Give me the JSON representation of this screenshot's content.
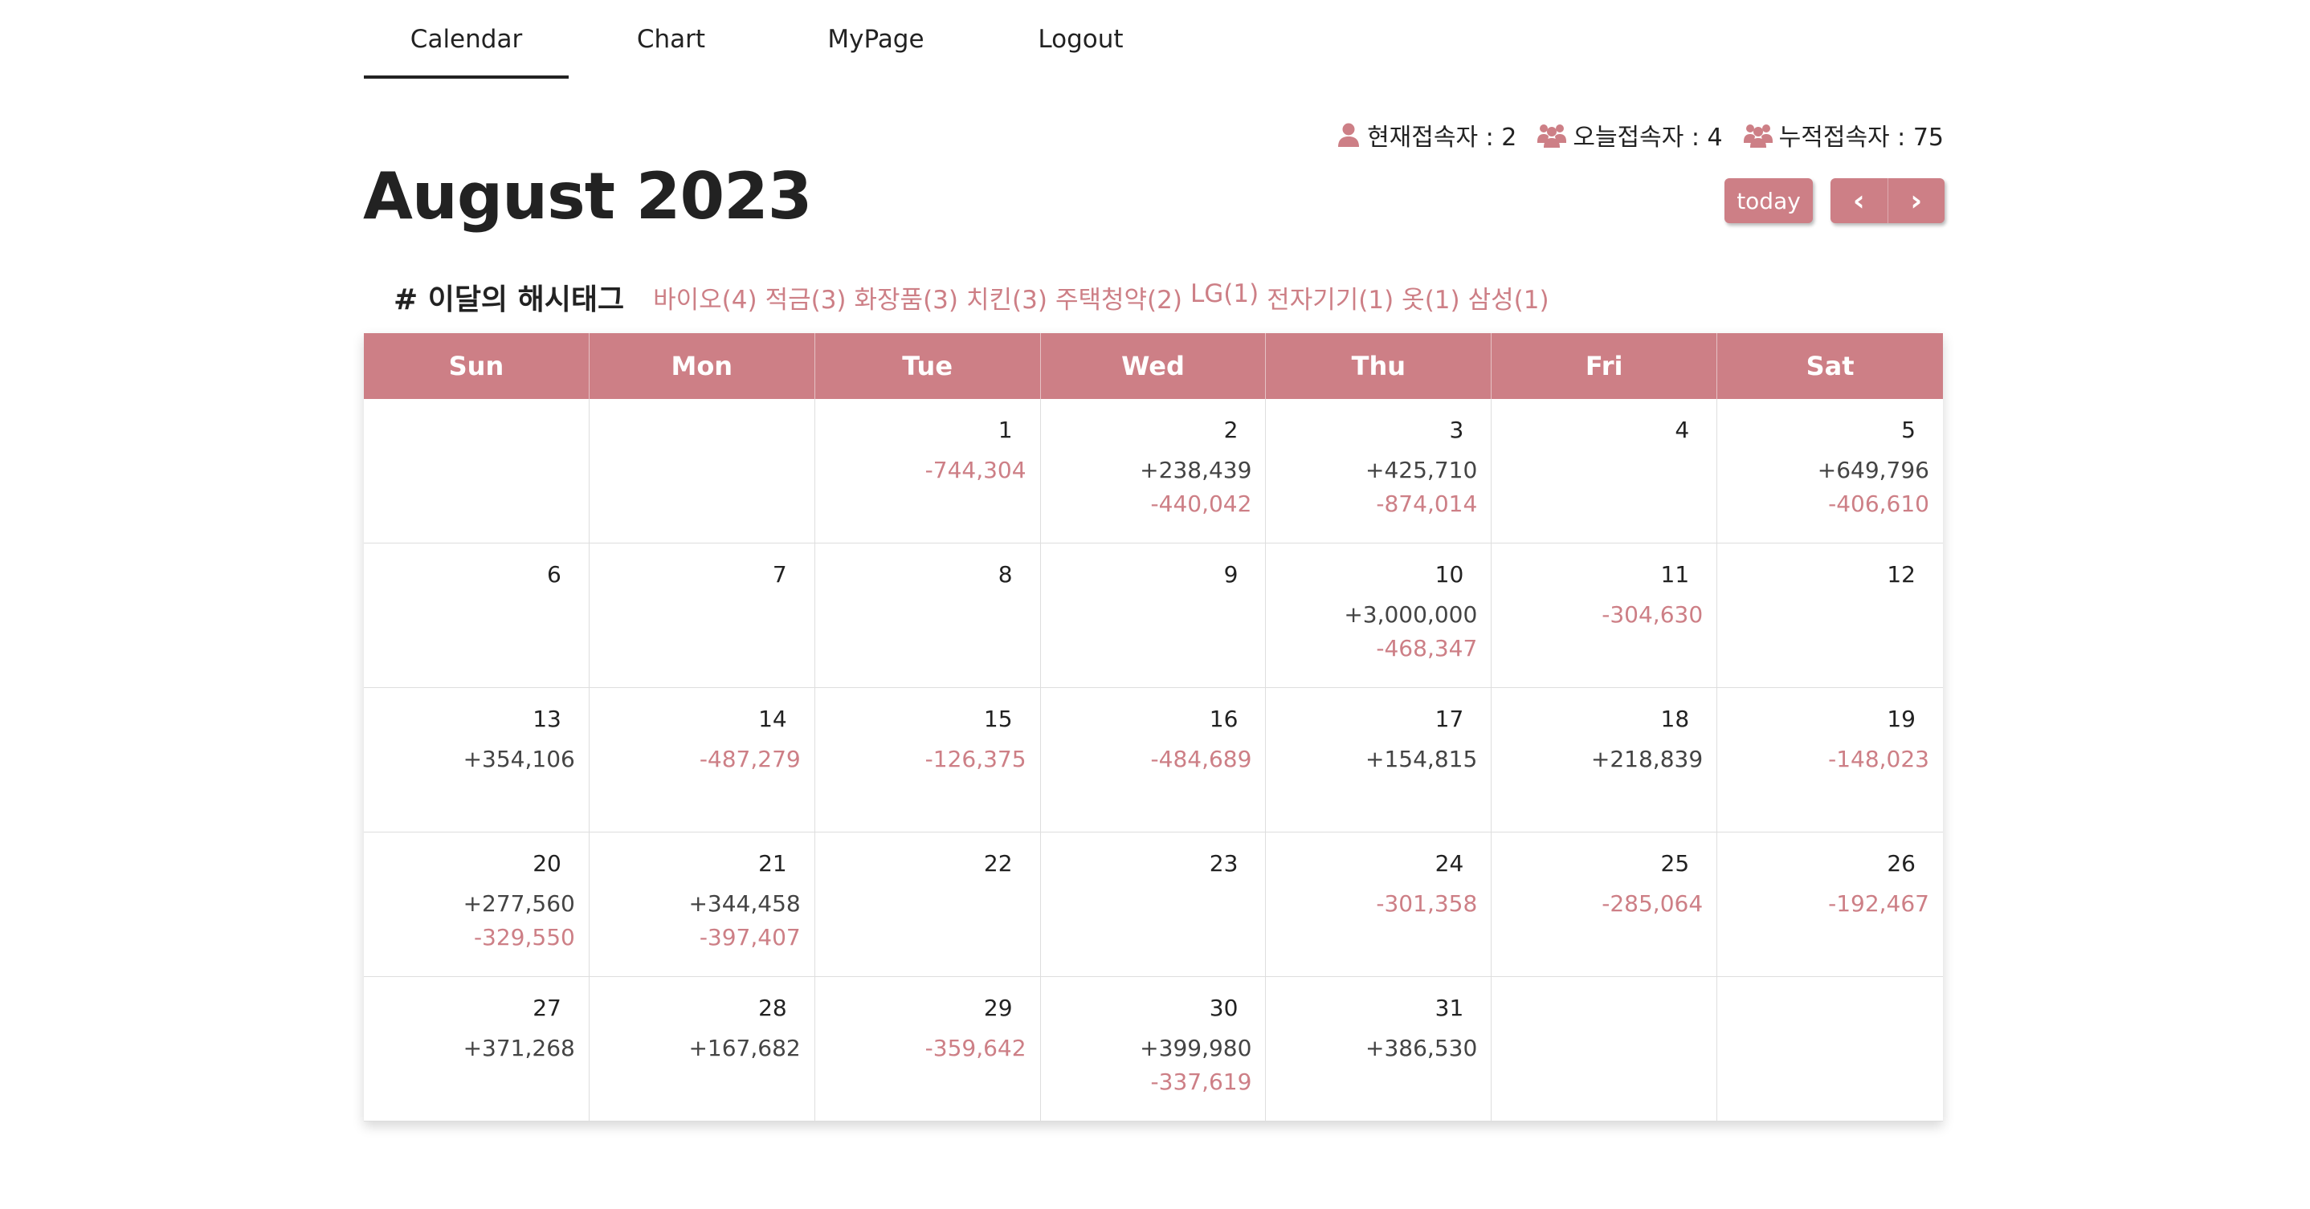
{
  "nav": {
    "items": [
      {
        "label": "Calendar",
        "active": true
      },
      {
        "label": "Chart",
        "active": false
      },
      {
        "label": "MyPage",
        "active": false
      },
      {
        "label": "Logout",
        "active": false
      }
    ]
  },
  "stats": {
    "current": "현재접속자 : 2",
    "today": "오늘접속자 : 4",
    "total": "누적접속자 : 75"
  },
  "header": {
    "title": "August 2023",
    "today_label": "today",
    "prev_label": "‹",
    "next_label": "›"
  },
  "hashtags": {
    "label": "# 이달의 해시태그",
    "tags": [
      "바이오(4)",
      "적금(3)",
      "화장품(3)",
      "치킨(3)",
      "주택청약(2)",
      "LG(1)",
      "전자기기(1)",
      "옷(1)",
      "삼성(1)"
    ]
  },
  "calendar": {
    "weekdays": [
      "Sun",
      "Mon",
      "Tue",
      "Wed",
      "Thu",
      "Fri",
      "Sat"
    ],
    "cells": [
      {
        "day": "",
        "income": "",
        "expense": ""
      },
      {
        "day": "",
        "income": "",
        "expense": ""
      },
      {
        "day": "1",
        "income": "",
        "expense": "-744,304"
      },
      {
        "day": "2",
        "income": "+238,439",
        "expense": "-440,042"
      },
      {
        "day": "3",
        "income": "+425,710",
        "expense": "-874,014"
      },
      {
        "day": "4",
        "income": "",
        "expense": ""
      },
      {
        "day": "5",
        "income": "+649,796",
        "expense": "-406,610"
      },
      {
        "day": "6",
        "income": "",
        "expense": ""
      },
      {
        "day": "7",
        "income": "",
        "expense": ""
      },
      {
        "day": "8",
        "income": "",
        "expense": ""
      },
      {
        "day": "9",
        "income": "",
        "expense": ""
      },
      {
        "day": "10",
        "income": "+3,000,000",
        "expense": "-468,347"
      },
      {
        "day": "11",
        "income": "",
        "expense": "-304,630"
      },
      {
        "day": "12",
        "income": "",
        "expense": ""
      },
      {
        "day": "13",
        "income": "+354,106",
        "expense": ""
      },
      {
        "day": "14",
        "income": "",
        "expense": "-487,279"
      },
      {
        "day": "15",
        "income": "",
        "expense": "-126,375"
      },
      {
        "day": "16",
        "income": "",
        "expense": "-484,689"
      },
      {
        "day": "17",
        "income": "+154,815",
        "expense": ""
      },
      {
        "day": "18",
        "income": "+218,839",
        "expense": ""
      },
      {
        "day": "19",
        "income": "",
        "expense": "-148,023"
      },
      {
        "day": "20",
        "income": "+277,560",
        "expense": "-329,550"
      },
      {
        "day": "21",
        "income": "+344,458",
        "expense": "-397,407"
      },
      {
        "day": "22",
        "income": "",
        "expense": ""
      },
      {
        "day": "23",
        "income": "",
        "expense": ""
      },
      {
        "day": "24",
        "income": "",
        "expense": "-301,358"
      },
      {
        "day": "25",
        "income": "",
        "expense": "-285,064"
      },
      {
        "day": "26",
        "income": "",
        "expense": "-192,467"
      },
      {
        "day": "27",
        "income": "+371,268",
        "expense": ""
      },
      {
        "day": "28",
        "income": "+167,682",
        "expense": ""
      },
      {
        "day": "29",
        "income": "",
        "expense": "-359,642"
      },
      {
        "day": "30",
        "income": "+399,980",
        "expense": "-337,619"
      },
      {
        "day": "31",
        "income": "+386,530",
        "expense": ""
      },
      {
        "day": "",
        "income": "",
        "expense": ""
      },
      {
        "day": "",
        "income": "",
        "expense": ""
      }
    ]
  },
  "colors": {
    "accent": "#cd7f86",
    "text": "#222222",
    "grid": "#dedede"
  },
  "icons": {
    "current_visitors": "person-icon",
    "today_visitors": "people-group-icon",
    "total_visitors": "people-group-icon"
  }
}
